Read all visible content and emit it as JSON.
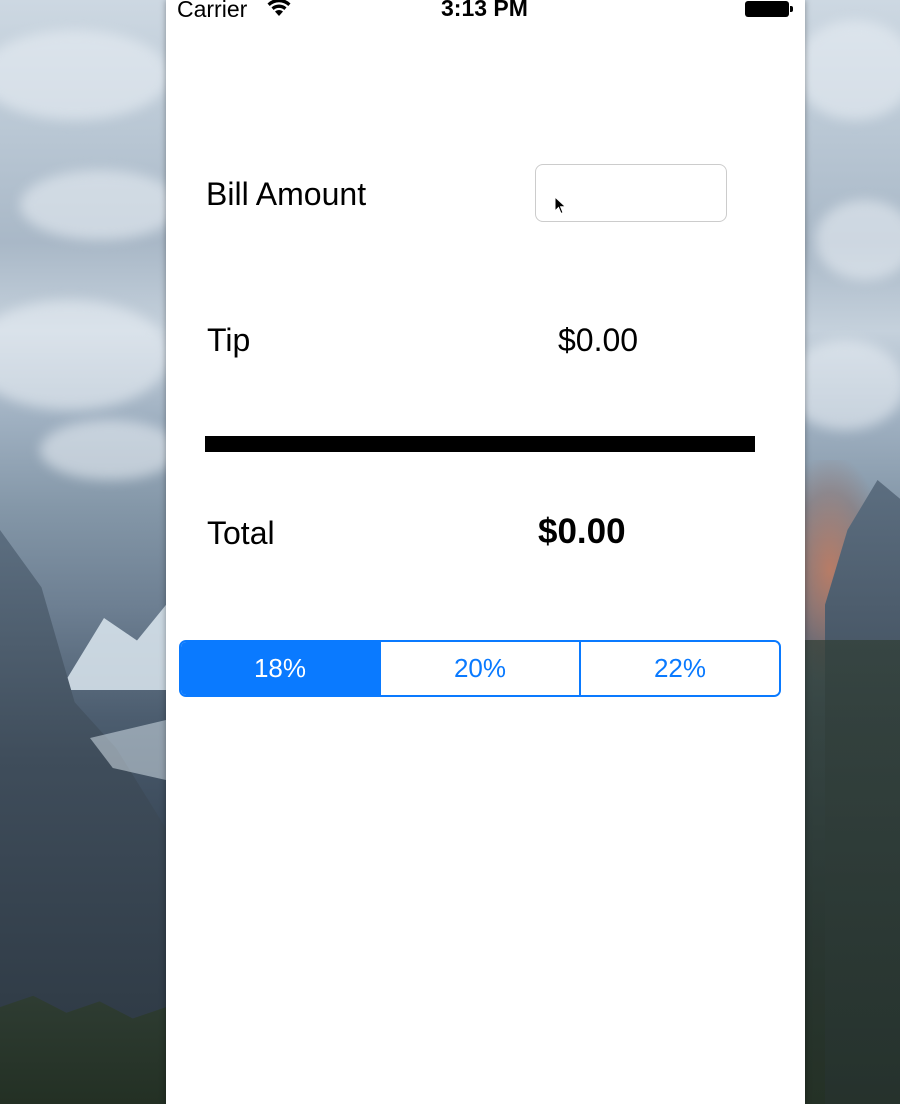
{
  "status_bar": {
    "carrier": "Carrier",
    "time": "3:13 PM",
    "wifi_icon": "wifi-icon",
    "battery_icon": "battery-icon"
  },
  "bill": {
    "label": "Bill Amount",
    "value": "",
    "placeholder": ""
  },
  "tip": {
    "label": "Tip",
    "value": "$0.00"
  },
  "total": {
    "label": "Total",
    "value": "$0.00"
  },
  "tip_selector": {
    "options": [
      "18%",
      "20%",
      "22%"
    ],
    "selected": "18%"
  },
  "colors": {
    "accent": "#0a7aff",
    "text": "#000000",
    "screen_background": "#ffffff"
  }
}
